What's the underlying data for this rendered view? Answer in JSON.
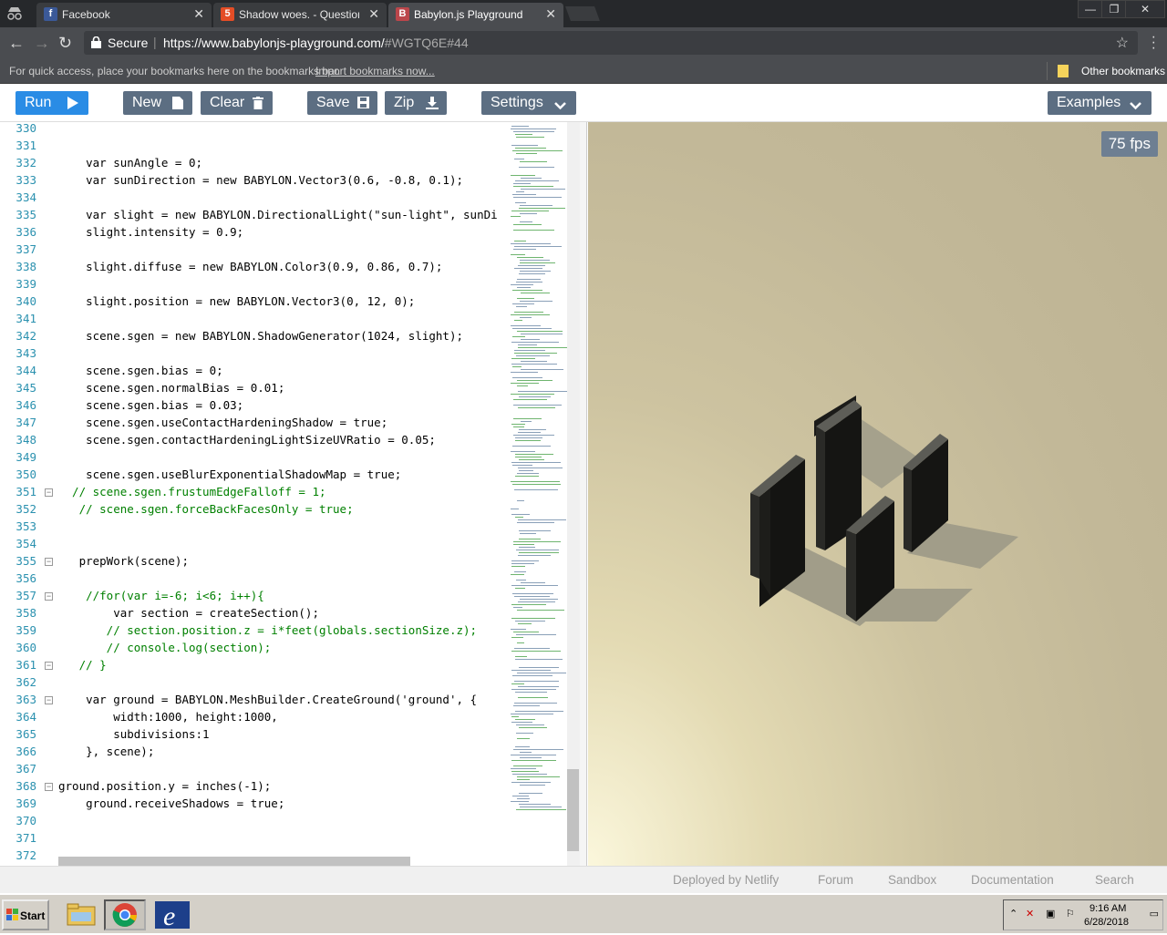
{
  "browser": {
    "tabs": [
      {
        "label": "Facebook",
        "icon": "facebook-icon"
      },
      {
        "label": "Shadow woes. - Questions",
        "icon": "html5-icon"
      },
      {
        "label": "Babylon.js Playground",
        "icon": "babylon-icon"
      }
    ],
    "secure_label": "Secure",
    "url_main": "https://www.babylonjs-playground.com/",
    "url_hash": "#WGTQ6E#44",
    "bookmarks_hint": "For quick access, place your bookmarks here on the bookmarks bar.",
    "bookmarks_import": "Import bookmarks now...",
    "other_bookmarks": "Other bookmarks"
  },
  "toolbar": {
    "run": "Run",
    "new": "New",
    "clear": "Clear",
    "save": "Save",
    "zip": "Zip",
    "settings": "Settings",
    "examples": "Examples"
  },
  "editor": {
    "line_numbers": [
      "330",
      "331",
      "332",
      "333",
      "334",
      "335",
      "336",
      "337",
      "338",
      "339",
      "340",
      "341",
      "342",
      "343",
      "344",
      "345",
      "346",
      "347",
      "348",
      "349",
      "350",
      "351",
      "352",
      "353",
      "354",
      "355",
      "356",
      "357",
      "358",
      "359",
      "360",
      "361",
      "362",
      "363",
      "364",
      "365",
      "366",
      "367",
      "368",
      "369",
      "370",
      "371",
      "372"
    ],
    "fold_lines": [
      "351",
      "355",
      "357",
      "361",
      "363",
      "368"
    ],
    "code": {
      "l332": "    var sunAngle = 0;",
      "l333": "    var sunDirection = new BABYLON.Vector3(0.6, -0.8, 0.1);",
      "l335": "    var slight = new BABYLON.DirectionalLight(\"sun-light\", sunDi",
      "l336": "    slight.intensity = 0.9;",
      "l338": "    slight.diffuse = new BABYLON.Color3(0.9, 0.86, 0.7);",
      "l340": "    slight.position = new BABYLON.Vector3(0, 12, 0);",
      "l342": "    scene.sgen = new BABYLON.ShadowGenerator(1024, slight);",
      "l344": "    scene.sgen.bias = 0;",
      "l345": "    scene.sgen.normalBias = 0.01;",
      "l346": "    scene.sgen.bias = 0.03;",
      "l347": "    scene.sgen.useContactHardeningShadow = true;",
      "l348": "    scene.sgen.contactHardeningLightSizeUVRatio = 0.05;",
      "l350": "    scene.sgen.useBlurExponentialShadowMap = true;",
      "l351": "  // scene.sgen.frustumEdgeFalloff = 1;",
      "l352": "   // scene.sgen.forceBackFacesOnly = true;",
      "l355": "   prepWork(scene);",
      "l357": "    //for(var i=-6; i<6; i++){",
      "l358": "        var section = createSection();",
      "l359": "       // section.position.z = i*feet(globals.sectionSize.z);",
      "l360": "       // console.log(section);",
      "l361": "   // }",
      "l363": "    var ground = BABYLON.MeshBuilder.CreateGround('ground', {",
      "l364": "        width:1000, height:1000,",
      "l365": "        subdivisions:1",
      "l366": "    }, scene);",
      "l368": "ground.position.y = inches(-1);",
      "l369": "    ground.receiveShadows = true;"
    }
  },
  "canvas": {
    "fps": "75 fps"
  },
  "footer": {
    "links": [
      "Deployed by Netlify",
      "Forum",
      "Sandbox",
      "Documentation",
      "Search"
    ]
  },
  "taskbar": {
    "start": "Start",
    "time": "9:16 AM",
    "date": "6/28/2018"
  }
}
